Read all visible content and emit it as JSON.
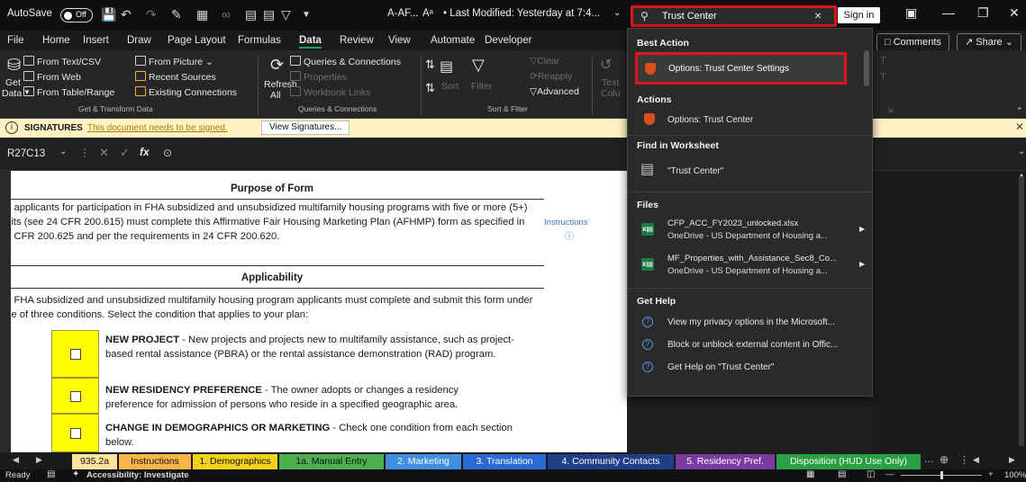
{
  "titlebar": {
    "autosave_label": "AutoSave",
    "autosave_state": "Off",
    "file_name": "A-AF...",
    "modified": "• Last Modified: Yesterday at 7:4...",
    "search_value": "Trust Center",
    "sign_in": "Sign in"
  },
  "tabs": [
    "File",
    "Home",
    "Insert",
    "Draw",
    "Page Layout",
    "Formulas",
    "Data",
    "Review",
    "View",
    "Automate",
    "Developer"
  ],
  "active_tab": "Data",
  "ribbon_right": {
    "comments": "Comments",
    "share": "Share"
  },
  "ribbon": {
    "from_text_csv": "From Text/CSV",
    "from_web": "From Web",
    "from_table_range": "From Table/Range",
    "get_data": "Get",
    "get_data2": "Data",
    "from_picture": "From Picture",
    "recent_sources": "Recent Sources",
    "existing_connections": "Existing Connections",
    "group_get_transform": "Get & Transform Data",
    "refresh": "Refresh",
    "refresh2": "All",
    "queries_connections": "Queries & Connections",
    "properties": "Properties",
    "workbook_links": "Workbook Links",
    "group_queries": "Queries & Connections",
    "sort": "Sort",
    "filter": "Filter",
    "clear": "Clear",
    "reapply": "Reapply",
    "advanced": "Advanced",
    "group_sort_filter": "Sort & Filter",
    "text_partial": "Text",
    "colu_partial": "Colu"
  },
  "signature_bar": {
    "title": "SIGNATURES",
    "message": "This document needs to be signed.",
    "button": "View Signatures..."
  },
  "formula_bar": {
    "name_box": "R27C13",
    "fx": "fx"
  },
  "sheet": {
    "purpose_heading": "Purpose of Form",
    "purpose_text": "All applicants for participation in FHA subsidized and unsubsidized multifamily housing programs with five or more (5+) units (see 24 CFR 200.615) must complete this Affirmative Fair Housing Marketing Plan (AFHMP) form as specified in 24 CFR 200.625 and per the requirements in 24 CFR 200.620.",
    "instructions_link": "Instructions",
    "applicability_heading": "Applicability",
    "applicability_text": "All FHA subsidized and unsubsidized multifamily housing program applicants must complete and submit this form under one of three conditions. Select the condition that applies to your plan:",
    "options": [
      {
        "title": "NEW PROJECT",
        "text": " - New projects and projects new to multifamily assistance, such as project-based rental assistance (PBRA) or the rental assistance demonstration (RAD) program."
      },
      {
        "title": "NEW RESIDENCY PREFERENCE",
        "text": " - The owner adopts or changes a residency preference for admission of persons who reside in a specified geographic area."
      },
      {
        "title": "CHANGE IN DEMOGRAPHICS OR MARKETING",
        "text": " - Check one condition from each section below."
      }
    ]
  },
  "search_dropdown": {
    "best_action_header": "Best Action",
    "best_action": "Options: Trust Center Settings",
    "actions_header": "Actions",
    "action_1": "Options: Trust Center",
    "find_header": "Find in Worksheet",
    "find_item": "\"Trust Center\"",
    "files_header": "Files",
    "files": [
      {
        "name": "CFP_ACC_FY2023_unlocked.xlsx",
        "location": "OneDrive - US Department of Housing a..."
      },
      {
        "name": "MF_Properties_with_Assistance_Sec8_Co...",
        "location": "OneDrive - US Department of Housing a..."
      }
    ],
    "help_header": "Get Help",
    "help_items": [
      "View my privacy options in the Microsoft...",
      "Block or unblock external content in Offic...",
      "Get Help on \"Trust Center\""
    ]
  },
  "sheet_tabs": [
    {
      "label": "935.2a",
      "bg": "#fde3a0",
      "fg": "#111111"
    },
    {
      "label": "Instructions",
      "bg": "#f7b54a",
      "fg": "#111111"
    },
    {
      "label": "1. Demographics",
      "bg": "#f3d21c",
      "fg": "#111111"
    },
    {
      "label": "1a. Manual Entry",
      "bg": "#4caf50",
      "fg": "#111111"
    },
    {
      "label": "2. Marketing",
      "bg": "#3f8fe0",
      "fg": "#ffffff"
    },
    {
      "label": "3. Translation",
      "bg": "#2a6bd1",
      "fg": "#ffffff"
    },
    {
      "label": "4. Community Contacts",
      "bg": "#1f3f8a",
      "fg": "#ffffff"
    },
    {
      "label": "5. Residency Pref.",
      "bg": "#7a3aa0",
      "fg": "#ffffff"
    },
    {
      "label": "Disposition (HUD Use Only)",
      "bg": "#29a043",
      "fg": "#ffffff"
    }
  ],
  "statusbar": {
    "ready": "Ready",
    "accessibility": "Accessibility: Investigate",
    "zoom": "100%"
  }
}
